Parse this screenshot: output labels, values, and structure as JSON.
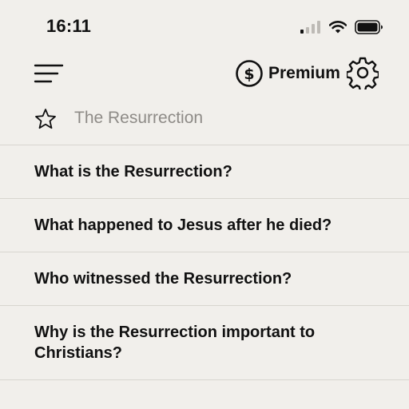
{
  "status_bar": {
    "time": "16:11",
    "icons": [
      "signal-icon",
      "wifi-icon",
      "battery-icon"
    ]
  },
  "header": {
    "menu_icon": "hamburger-menu-icon",
    "premium_icon": "dollar-circle-icon",
    "premium_label": "Premium",
    "settings_icon": "gear-icon"
  },
  "topic": {
    "star_icon": "star-outline-icon",
    "title": "The Resurrection"
  },
  "questions": [
    {
      "text": "What is the Resurrection?"
    },
    {
      "text": "What happened to Jesus after he died?"
    },
    {
      "text": "Who witnessed the Resurrection?"
    },
    {
      "text": "Why is the Resurrection important to Christians?"
    }
  ],
  "colors": {
    "background": "#f1efeb",
    "text": "#111111",
    "muted_text": "#8e8b87",
    "divider": "#d8d5cf"
  }
}
